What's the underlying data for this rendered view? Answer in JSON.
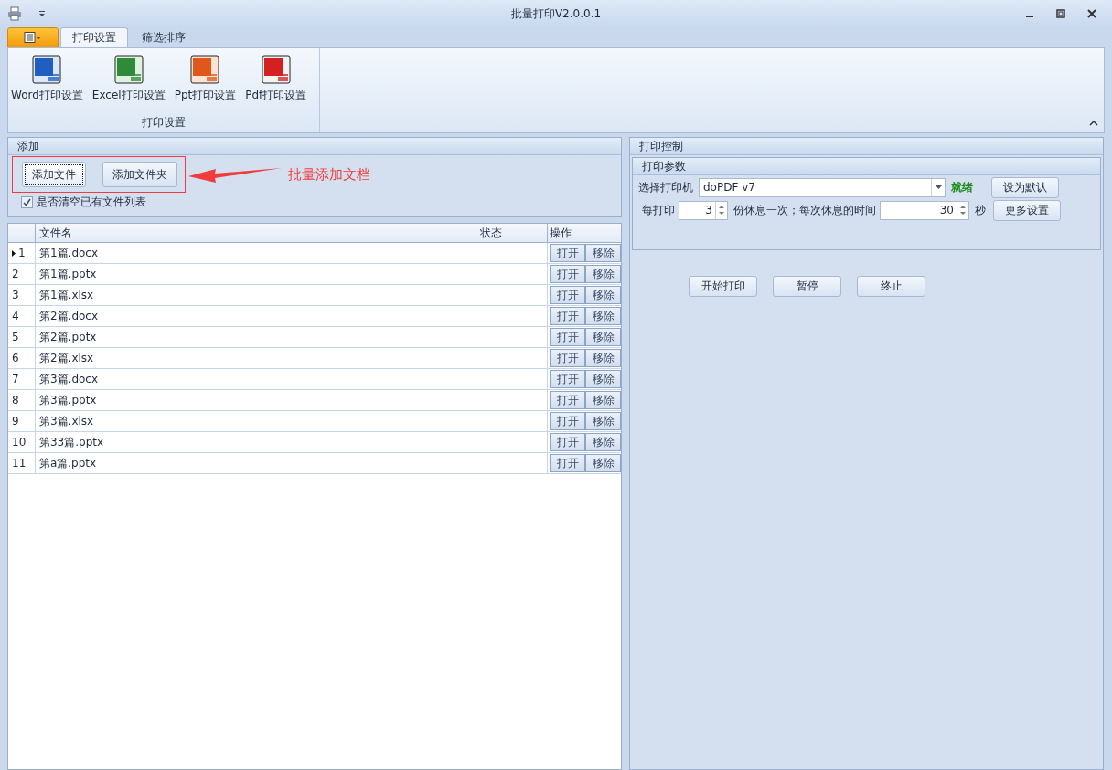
{
  "window": {
    "title": "批量打印V2.0.0.1"
  },
  "tabs": [
    {
      "label": "打印设置",
      "selected": true
    },
    {
      "label": "筛选排序",
      "selected": false
    }
  ],
  "ribbon": {
    "group_label": "打印设置",
    "buttons": [
      {
        "label": "Word打印设置",
        "kind": "word"
      },
      {
        "label": "Excel打印设置",
        "kind": "excel"
      },
      {
        "label": "Ppt打印设置",
        "kind": "ppt"
      },
      {
        "label": "Pdf打印设置",
        "kind": "pdf"
      }
    ]
  },
  "add_panel": {
    "title": "添加",
    "buttons": [
      {
        "label": "添加文件",
        "focused": true
      },
      {
        "label": "添加文件夹",
        "focused": false
      }
    ],
    "clear_list": {
      "label": "是否清空已有文件列表",
      "checked": true
    },
    "annotation": "批量添加文档"
  },
  "table": {
    "columns": [
      "文件名",
      "状态",
      "操作"
    ],
    "rows": [
      {
        "index": "1",
        "name": "第1篇.docx",
        "selected": true,
        "actions": [
          "打开",
          "移除"
        ]
      },
      {
        "index": "2",
        "name": "第1篇.pptx",
        "selected": false,
        "actions": [
          "打开",
          "移除"
        ]
      },
      {
        "index": "3",
        "name": "第1篇.xlsx",
        "selected": false,
        "actions": [
          "打开",
          "移除"
        ]
      },
      {
        "index": "4",
        "name": "第2篇.docx",
        "selected": false,
        "actions": [
          "打开",
          "移除"
        ]
      },
      {
        "index": "5",
        "name": "第2篇.pptx",
        "selected": false,
        "actions": [
          "打开",
          "移除"
        ]
      },
      {
        "index": "6",
        "name": "第2篇.xlsx",
        "selected": false,
        "actions": [
          "打开",
          "移除"
        ]
      },
      {
        "index": "7",
        "name": "第3篇.docx",
        "selected": false,
        "actions": [
          "打开",
          "移除"
        ]
      },
      {
        "index": "8",
        "name": "第3篇.pptx",
        "selected": false,
        "actions": [
          "打开",
          "移除"
        ]
      },
      {
        "index": "9",
        "name": "第3篇.xlsx",
        "selected": false,
        "actions": [
          "打开",
          "移除"
        ]
      },
      {
        "index": "10",
        "name": "第33篇.pptx",
        "selected": false,
        "actions": [
          "打开",
          "移除"
        ]
      },
      {
        "index": "11",
        "name": "第a篇.pptx",
        "selected": false,
        "actions": [
          "打开",
          "移除"
        ]
      }
    ]
  },
  "control_panel": {
    "title": "打印控制",
    "params_title": "打印参数",
    "printer_label": "选择打印机",
    "printer": "doPDF v7",
    "status": "就绪",
    "set_default": "设为默认",
    "every_label": "每打印",
    "every_value": "3",
    "rest_label": "份休息一次；每次休息的时间",
    "rest_value": "30",
    "seconds_label": "秒",
    "more_settings": "更多设置",
    "actions": [
      "开始打印",
      "暂停",
      "终止"
    ]
  }
}
